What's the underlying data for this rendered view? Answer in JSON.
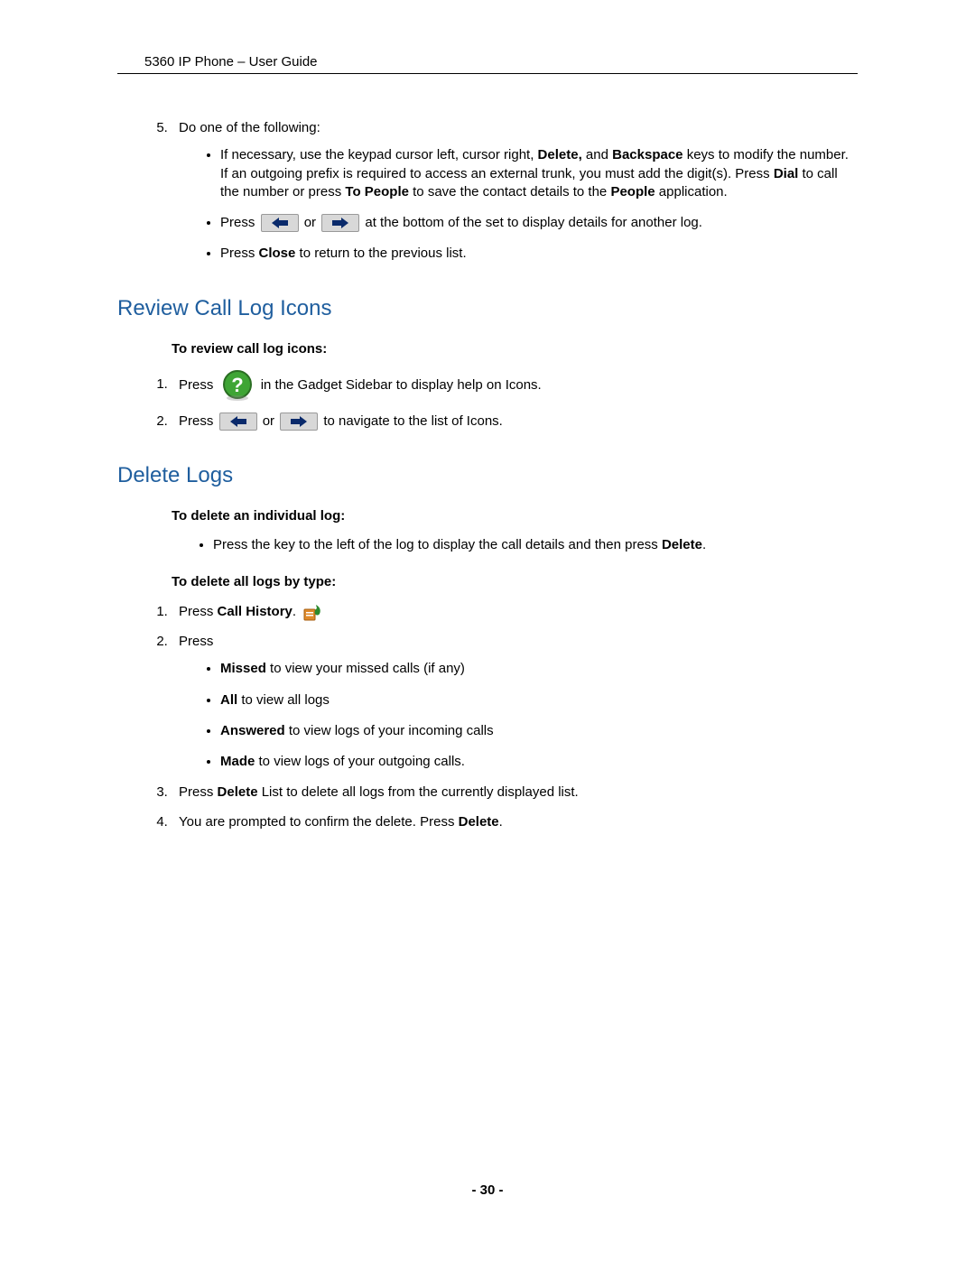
{
  "header": {
    "title": "5360 IP Phone – User Guide"
  },
  "step5": {
    "num": "5.",
    "lead": "Do one of the following:",
    "b1_pre": "If necessary, use the keypad cursor left, cursor right, ",
    "b1_delete": "Delete,",
    "b1_mid1": " and ",
    "b1_backspace": "Backspace",
    "b1_mid2": " keys to modify the number. If an outgoing prefix is required to access an external trunk, you must add the digit(s). Press ",
    "b1_dial": "Dial",
    "b1_mid3": " to call the number or press ",
    "b1_topeople": "To People",
    "b1_mid4": " to save the contact details to the ",
    "b1_people": "People",
    "b1_end": " application.",
    "b2_pre": "Press  ",
    "b2_or": " or ",
    "b2_post": " at the bottom of the set to display details for another log.",
    "b3_pre": "Press ",
    "b3_close": "Close",
    "b3_post": " to return to the previous list."
  },
  "review": {
    "heading": "Review Call Log Icons",
    "subhead": "To review call log icons:",
    "s1_pre": "Press  ",
    "s1_post": "  in the Gadget Sidebar to display help on Icons.",
    "s2_pre": "Press ",
    "s2_or": " or ",
    "s2_post": " to navigate to the list of Icons."
  },
  "delete": {
    "heading": "Delete Logs",
    "sub1": "To delete an individual log:",
    "b1_pre": "Press the key to the left of the log to display the call details and then press ",
    "b1_del": "Delete",
    "b1_post": ".",
    "sub2": "To delete all logs by type:",
    "s1_pre": "Press ",
    "s1_ch": "Call History",
    "s1_post": ". ",
    "s2": "Press",
    "s2b_missed_b": "Missed",
    "s2b_missed_t": " to view your missed calls (if any)",
    "s2b_all_b": "All",
    "s2b_all_t": " to view all logs",
    "s2b_ans_b": "Answered",
    "s2b_ans_t": " to view logs of your incoming calls",
    "s2b_made_b": "Made",
    "s2b_made_t": " to view logs of your outgoing calls.",
    "s3_pre": "Press ",
    "s3_del": "Delete",
    "s3_post": " List to delete all logs from the currently displayed list.",
    "s4_pre": "You are prompted to confirm the delete. Press ",
    "s4_del": "Delete",
    "s4_post": "."
  },
  "footer": {
    "page": "- 30 -"
  }
}
